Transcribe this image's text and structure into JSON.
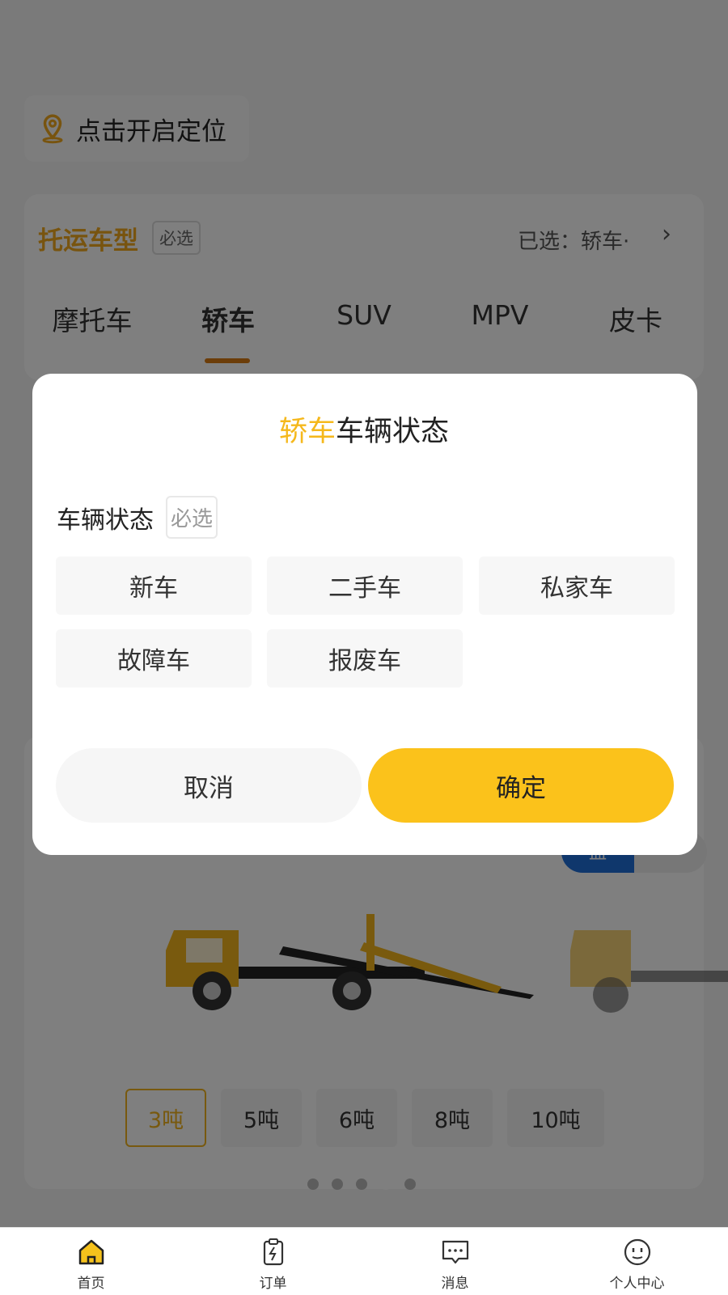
{
  "location": {
    "label": "点击开启定位"
  },
  "vehicle_type": {
    "title": "托运车型",
    "required_badge": "必选",
    "selected_text": "已选：轿车·",
    "tabs": [
      "摩托车",
      "轿车",
      "SUV",
      "MPV",
      "皮卡"
    ],
    "active_tab_index": 1
  },
  "truck_card": {
    "toggle": {
      "on": "皿",
      "off": ""
    },
    "tonnage": [
      "3吨",
      "5吨",
      "6吨",
      "8吨",
      "10吨"
    ],
    "selected_tonnage_index": 0,
    "carousel": {
      "count": 5,
      "active_index": 3
    }
  },
  "modal": {
    "title_accent": "轿车",
    "title_rest": "车辆状态",
    "section_label": "车辆状态",
    "required_badge": "必选",
    "options": [
      "新车",
      "二手车",
      "私家车",
      "故障车",
      "报废车"
    ],
    "cancel_label": "取消",
    "confirm_label": "确定"
  },
  "bottom_nav": {
    "items": [
      {
        "label": "首页",
        "icon": "home-icon"
      },
      {
        "label": "订单",
        "icon": "order-clipboard-icon"
      },
      {
        "label": "消息",
        "icon": "message-icon"
      },
      {
        "label": "个人中心",
        "icon": "profile-icon"
      }
    ]
  },
  "colors": {
    "accent_yellow": "#fbc21b",
    "accent_orange": "#f0a81e",
    "toggle_blue": "#1e6fd9"
  }
}
